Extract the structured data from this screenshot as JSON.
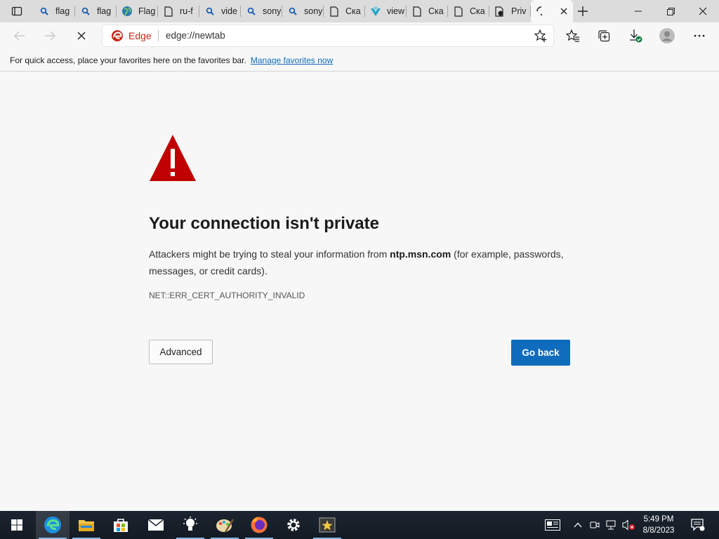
{
  "tabs": [
    {
      "label": "flag",
      "icon": "search-icon"
    },
    {
      "label": "flag",
      "icon": "search-icon"
    },
    {
      "label": "Flag",
      "icon": "globe-icon"
    },
    {
      "label": "ru-f",
      "icon": "document-icon"
    },
    {
      "label": "vide",
      "icon": "search-icon"
    },
    {
      "label": "sony",
      "icon": "search-icon"
    },
    {
      "label": "sony",
      "icon": "search-icon"
    },
    {
      "label": "Ска",
      "icon": "document-icon"
    },
    {
      "label": "view",
      "icon": "vk-icon"
    },
    {
      "label": "Ска",
      "icon": "document-icon"
    },
    {
      "label": "Ска",
      "icon": "document-icon"
    },
    {
      "label": "Priv",
      "icon": "private-document-icon"
    }
  ],
  "active_tab": {
    "label": "",
    "icon": "loading-icon"
  },
  "omnibox": {
    "brand_label": "Edge",
    "url": "edge://newtab"
  },
  "favbar": {
    "text": "For quick access, place your favorites here on the favorites bar.",
    "link": "Manage favorites now"
  },
  "error": {
    "title": "Your connection isn't private",
    "desc_before": "Attackers might be trying to steal your information from ",
    "host": "ntp.msn.com",
    "desc_after": " (for example, passwords, messages, or credit cards).",
    "code": "NET::ERR_CERT_AUTHORITY_INVALID",
    "advanced_label": "Advanced",
    "goback_label": "Go back"
  },
  "taskbar": {
    "apps": [
      "edge-icon",
      "file-explorer-icon",
      "store-icon",
      "mail-icon",
      "tips-icon",
      "paint-icon",
      "firefox-icon",
      "settings-icon",
      "media-app-icon"
    ],
    "clock_time": "5:49 PM",
    "clock_date": "8/8/2023"
  },
  "colors": {
    "accent": "#0f6cbd",
    "warning": "#c00000",
    "edge_red": "#c42b1c"
  }
}
